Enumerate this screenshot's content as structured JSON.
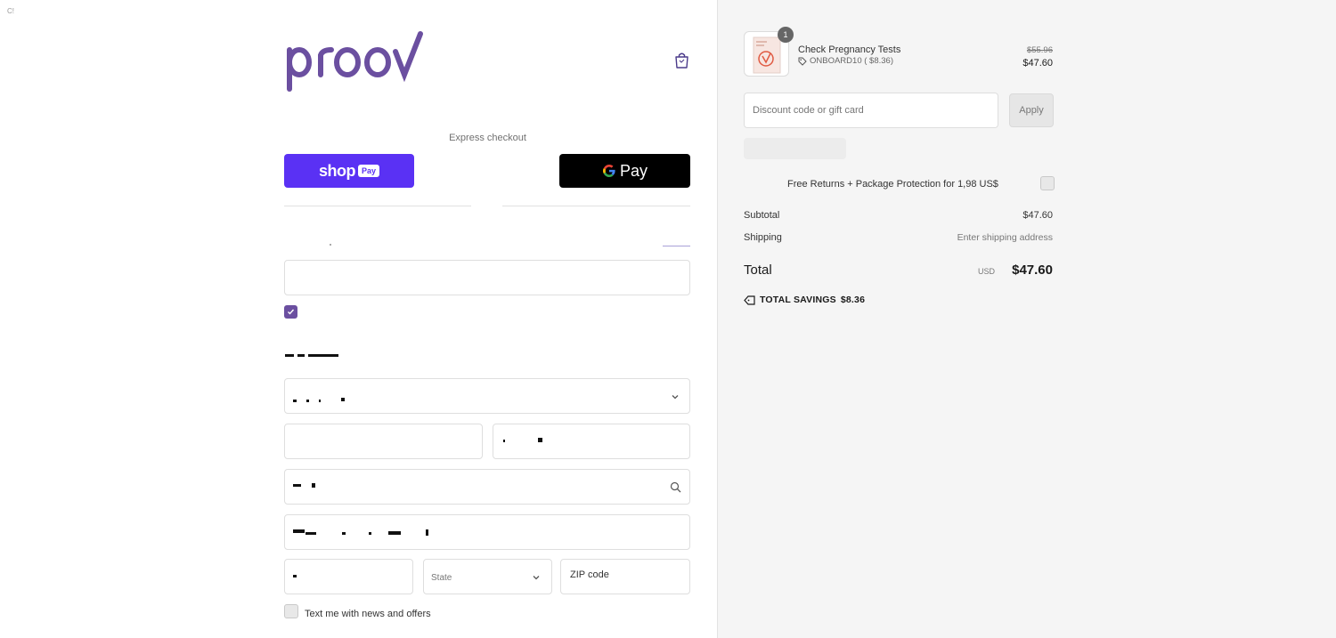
{
  "corner_mark": "C!",
  "brand": {
    "logo_text": "proov"
  },
  "express": {
    "label": "Express checkout",
    "shop_word": "shop",
    "shop_badge": "Pay",
    "gpay_text": "Pay"
  },
  "shipping_form": {
    "state_label": "State",
    "zip_label": "ZIP code",
    "sms_label": "Text me with news and offers"
  },
  "summary": {
    "quantity": "1",
    "product_name": "Check Pregnancy Tests",
    "discount_tag": "ONBOARD10 ( $8.36)",
    "price_original": "$55.96",
    "price_current": "$47.60",
    "discount_placeholder": "Discount code or gift card",
    "apply_label": "Apply",
    "protection_label": "Free Returns + Package Protection for 1,98 US$",
    "subtotal_label": "Subtotal",
    "subtotal_value": "$47.60",
    "shipping_label": "Shipping",
    "shipping_value": "Enter shipping address",
    "total_label": "Total",
    "total_currency": "USD",
    "total_value": "$47.60",
    "savings_label": "TOTAL SAVINGS",
    "savings_value": "$8.36"
  },
  "colors": {
    "brand_purple": "#6b4fa0",
    "shop_pay": "#5a31f4",
    "gpay": "#000000"
  }
}
